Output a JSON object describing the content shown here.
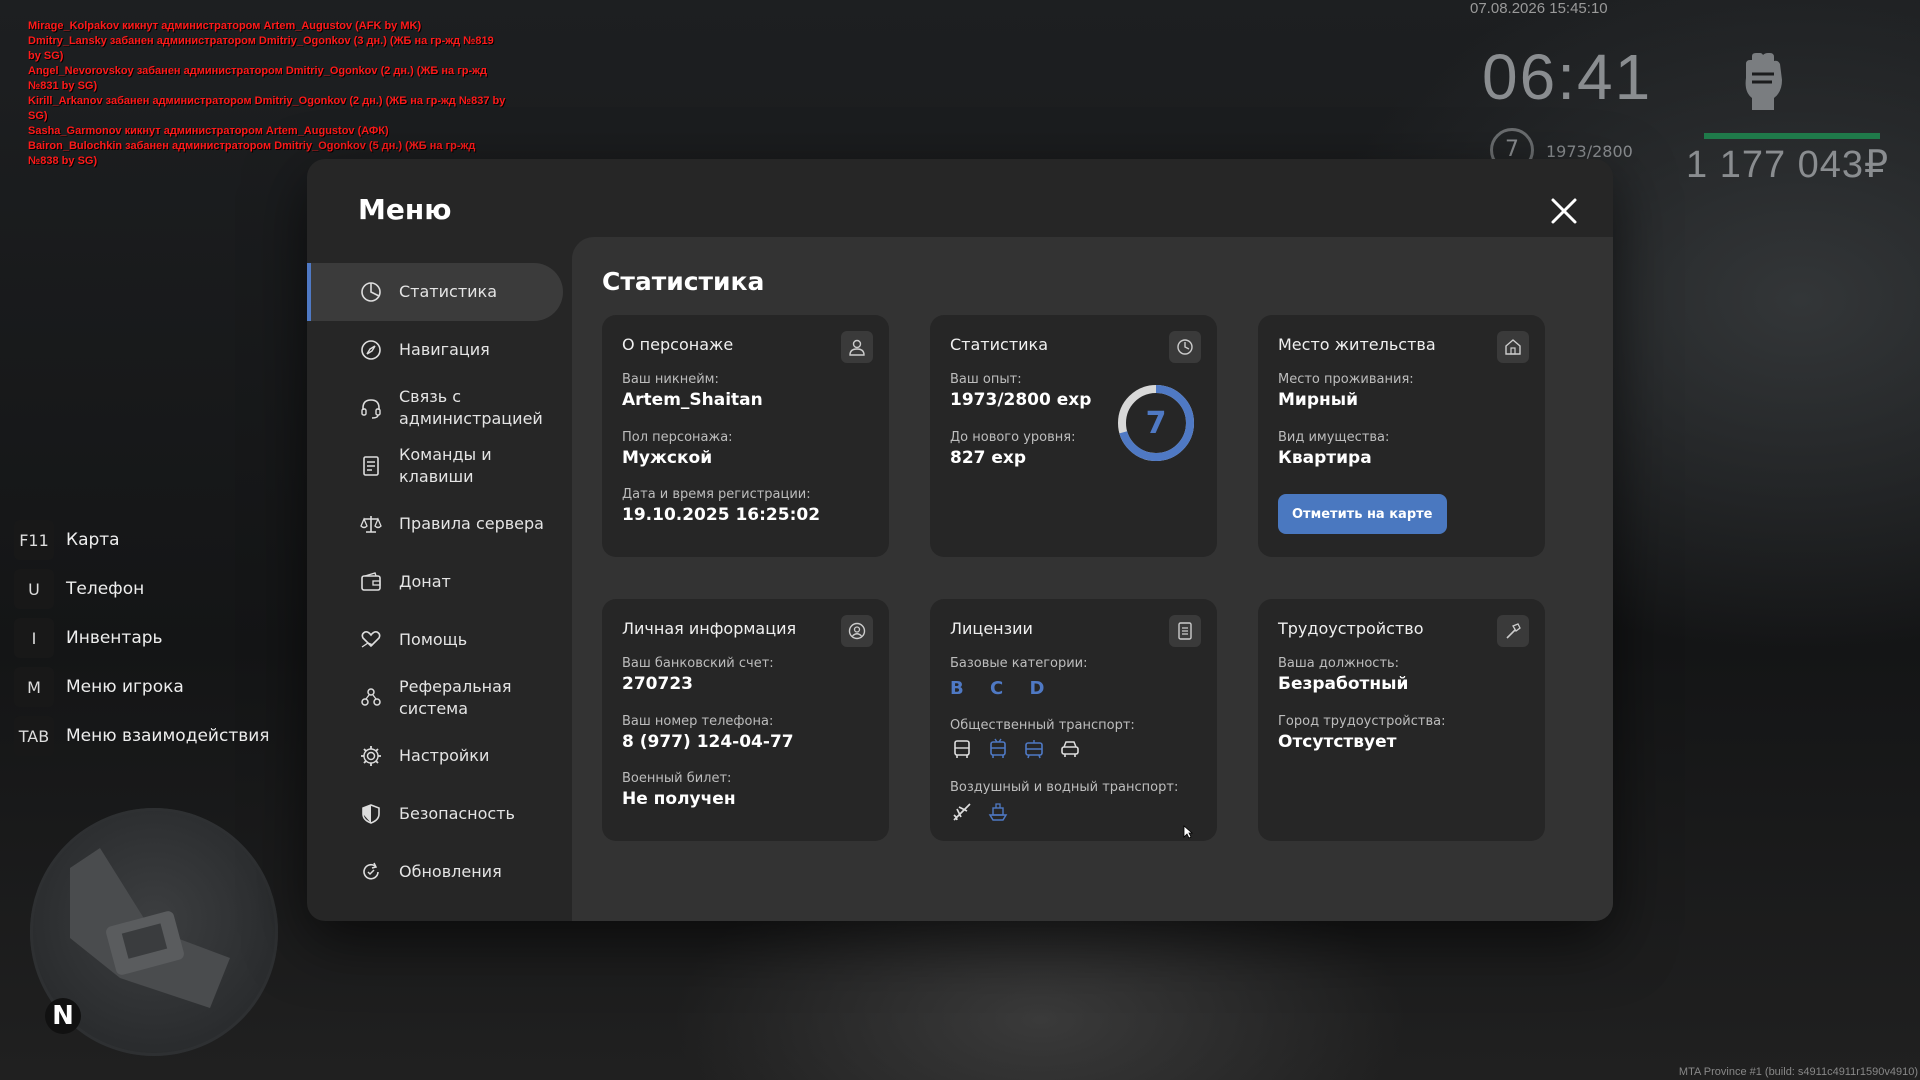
{
  "chat": [
    "Mirage_Kolpakov кикнут администратором Artem_Augustov (AFK by MK)",
    "Dmitry_Lansky забанен администратором Dmitriy_Ogonkov (3 дн.) (ЖБ на гр-жд №819 by SG)",
    "Angel_Nevorovskoy забанен администратором Dmitriy_Ogonkov (2 дн.) (ЖБ на гр-жд №831 by SG)",
    "Kirill_Arkanov забанен администратором Dmitriy_Ogonkov (2 дн.) (ЖБ на гр-жд №837 by SG)",
    "Sasha_Garmonov кикнут администратором Artem_Augustov (АФК)",
    "Bairon_Bulochkin забанен администратором Dmitriy_Ogonkov (5 дн.) (ЖБ на гр-жд №838 by SG)"
  ],
  "hud": {
    "date": "07.08.2026 15:45:10",
    "time": "06:41",
    "level": "7",
    "exp": "1973/2800",
    "money": "1 177 043₽"
  },
  "hotkeys": [
    {
      "key": "F11",
      "label": "Карта"
    },
    {
      "key": "U",
      "label": "Телефон"
    },
    {
      "key": "I",
      "label": "Инвентарь"
    },
    {
      "key": "M",
      "label": "Меню игрока"
    },
    {
      "key": "TAB",
      "label": "Меню взаимодействия"
    }
  ],
  "minimap": {
    "north": "N"
  },
  "build": "MTA Province #1 (build: s4911c4911r1590v4910)",
  "modal": {
    "title": "Меню",
    "sidebar": [
      {
        "label": "Статистика",
        "icon": "pie-chart-icon"
      },
      {
        "label": "Навигация",
        "icon": "compass-icon"
      },
      {
        "label": "Связь с администрацией",
        "icon": "headset-icon"
      },
      {
        "label": "Команды и клавиши",
        "icon": "document-icon"
      },
      {
        "label": "Правила сервера",
        "icon": "scales-icon"
      },
      {
        "label": "Донат",
        "icon": "wallet-icon"
      },
      {
        "label": "Помощь",
        "icon": "heart-hand-icon"
      },
      {
        "label": "Реферальная система",
        "icon": "people-icon"
      },
      {
        "label": "Настройки",
        "icon": "gear-icon"
      },
      {
        "label": "Безопасность",
        "icon": "shield-icon"
      },
      {
        "label": "Обновления",
        "icon": "refresh-icon"
      }
    ],
    "section_title": "Статистика",
    "cards": {
      "character": {
        "title": "О персонаже",
        "nick_label": "Ваш никнейм:",
        "nick": "Artem_Shaitan",
        "gender_label": "Пол персонажа:",
        "gender": "Мужской",
        "reg_label": "Дата и время регистрации:",
        "reg": "19.10.2025 16:25:02"
      },
      "stats": {
        "title": "Статистика",
        "exp_label": "Ваш опыт:",
        "exp": "1973/2800 exp",
        "next_label": "До нового уровня:",
        "next": "827 exp",
        "level": "7",
        "progress": 0.7046
      },
      "residence": {
        "title": "Место жительства",
        "place_label": "Место проживания:",
        "place": "Мирный",
        "prop_label": "Вид имущества:",
        "prop": "Квартира",
        "button": "Отметить на карте"
      },
      "personal": {
        "title": "Личная информация",
        "bank_label": "Ваш банковский счет:",
        "bank": "270723",
        "phone_label": "Ваш номер телефона:",
        "phone": "8 (977) 124-04-77",
        "mil_label": "Военный билет:",
        "mil": "Не получен"
      },
      "licenses": {
        "title": "Лицензии",
        "base_label": "Базовые категории:",
        "base": "B C D",
        "public_label": "Общественный транспорт:",
        "air_label": "Воздушный и водный транспорт:"
      },
      "job": {
        "title": "Трудоустройство",
        "pos_label": "Ваша должность:",
        "pos": "Безработный",
        "city_label": "Город трудоустройства:",
        "city": "Отсутствует"
      }
    }
  },
  "colors": {
    "accent": "#4f79c4",
    "button": "#4a78c0",
    "chat": "#ff1a1a",
    "money_bar": "#1f7a4a"
  }
}
